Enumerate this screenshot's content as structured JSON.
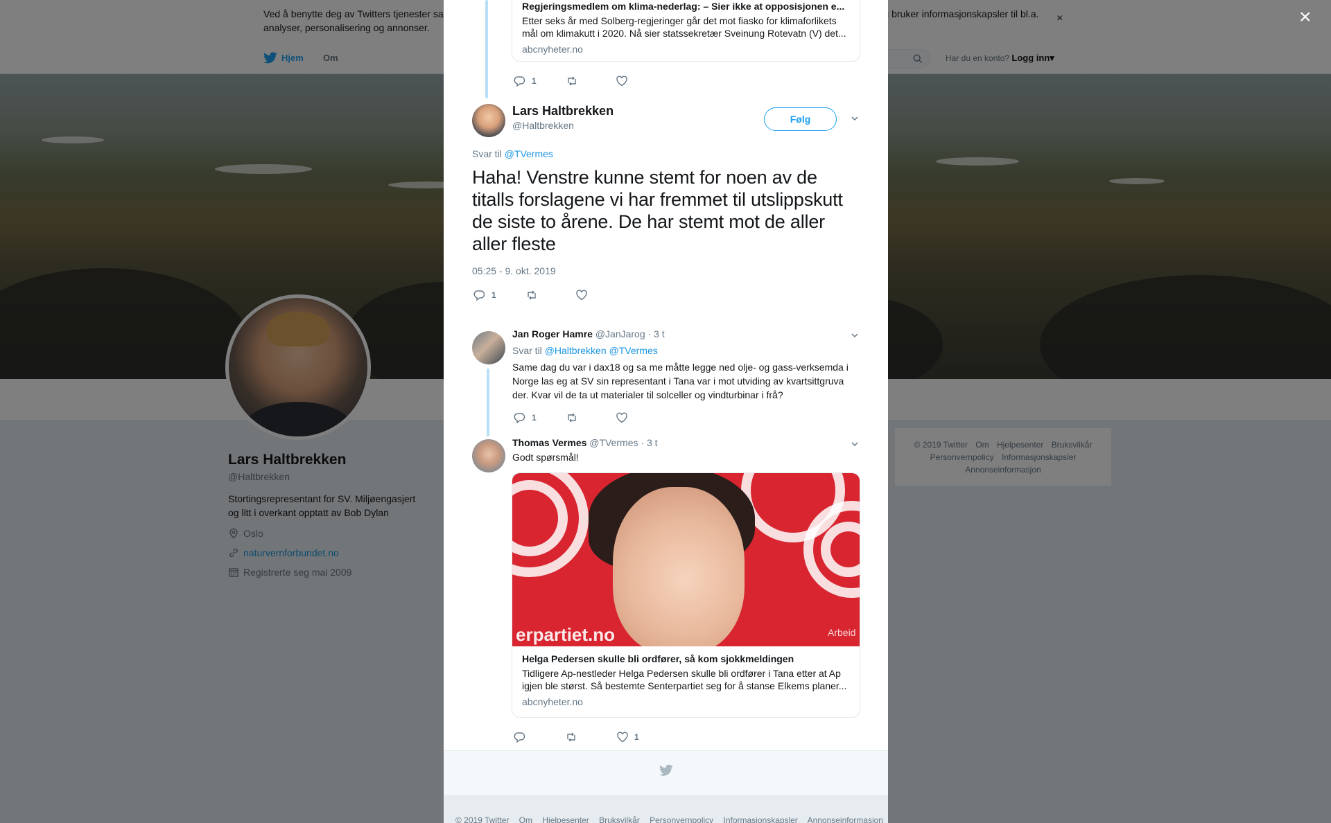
{
  "cookie_bar": {
    "text": "Ved å benytte deg av Twitters tjenester samtykker du til vår bruk av informasjonskapsler og deling av data. Vi og våre partnere opererer globalt og bruker informasjonskapsler til bl.a. analyser, personalisering og annonser.",
    "close": "×"
  },
  "nav": {
    "home": "Hjem",
    "about": "Om",
    "have_account": "Har du en konto?",
    "login": "Logg inn",
    "login_caret": "▾"
  },
  "profile": {
    "name": "Lars Haltbrekken",
    "handle": "@Haltbrekken",
    "bio": "Stortingsrepresentant for SV. Miljøengasjert og litt i overkant opptatt av Bob Dylan",
    "location": "Oslo",
    "website": "naturvernforbundet.no",
    "joined": "Registrerte seg mai 2009"
  },
  "side_footer": {
    "row1": [
      "© 2019 Twitter",
      "Om",
      "Hjelpesenter",
      "Bruksvilkår"
    ],
    "row2": [
      "Personvernpolicy",
      "Informasjonskapsler"
    ],
    "row3": [
      "Annonseinformasjon"
    ]
  },
  "modal": {
    "close": "×",
    "top_card": {
      "title": "Regjeringsmedlem om klima-nederlag: – Sier ikke at opposisjonen e...",
      "desc": "Etter seks år med Solberg-regjeringer går det mot fiasko for klimaforlikets mål om klimakutt i 2020. Nå sier statssekretær Sveinung Rotevatn (V) det...",
      "domain": "abcnyheter.no",
      "replies": "1"
    },
    "main_tweet": {
      "name": "Lars Haltbrekken",
      "handle": "@Haltbrekken",
      "follow": "Følg",
      "reply_to_label": "Svar til",
      "reply_to": "@TVermes",
      "text": "Haha! Venstre kunne stemt for noen av de titalls forslagene vi har fremmet til utslippskutt de siste to årene. De har stemt mot de aller aller fleste",
      "time": "05:25 - 9. okt. 2019",
      "replies": "1"
    },
    "reply1": {
      "name": "Jan Roger Hamre",
      "handle": "@JanJarog",
      "age": "· 3 t",
      "reply_to_label": "Svar til",
      "reply_to_1": "@Haltbrekken",
      "reply_to_2": "@TVermes",
      "text": "Same dag du var i dax18 og sa me måtte legge ned olje- og gass-verksemda i Norge las eg at SV sin representant i Tana var i mot utviding av kvartsittgruva der. Kvar vil de ta ut materialer til solceller og vindturbinar i frå?",
      "replies": "1"
    },
    "reply2": {
      "name": "Thomas Vermes",
      "handle": "@TVermes",
      "age": "· 3 t",
      "text": "Godt spørsmål!",
      "card_image_text": "erpartiet.no",
      "card_image_text_right": "Arbeid",
      "card_title": "Helga Pedersen skulle bli ordfører, så kom sjokkmeldingen",
      "card_desc": "Tidligere Ap-nestleder Helga Pedersen skulle bli ordfører i Tana etter at Ap igjen ble størst. Så bestemte Senterpartiet seg for å stanse Elkems planer...",
      "card_domain": "abcnyheter.no",
      "likes": "1"
    }
  },
  "footer": {
    "links": [
      "© 2019 Twitter",
      "Om",
      "Hjelpesenter",
      "Bruksvilkår",
      "Personvernpolicy",
      "Informasjonskapsler",
      "Annonseinformasjon"
    ]
  },
  "colors": {
    "twitter_blue": "#1da1f2",
    "link_blue": "#1b95e0",
    "gray_text": "#657786",
    "thread_line": "#b7dff8",
    "overlay": "rgba(0,0,0,0.5)"
  },
  "icons": [
    "twitter-bird-icon",
    "search-icon",
    "close-icon",
    "reply-icon",
    "retweet-icon",
    "like-icon",
    "chevron-down-icon",
    "location-icon",
    "link-icon",
    "calendar-icon"
  ]
}
